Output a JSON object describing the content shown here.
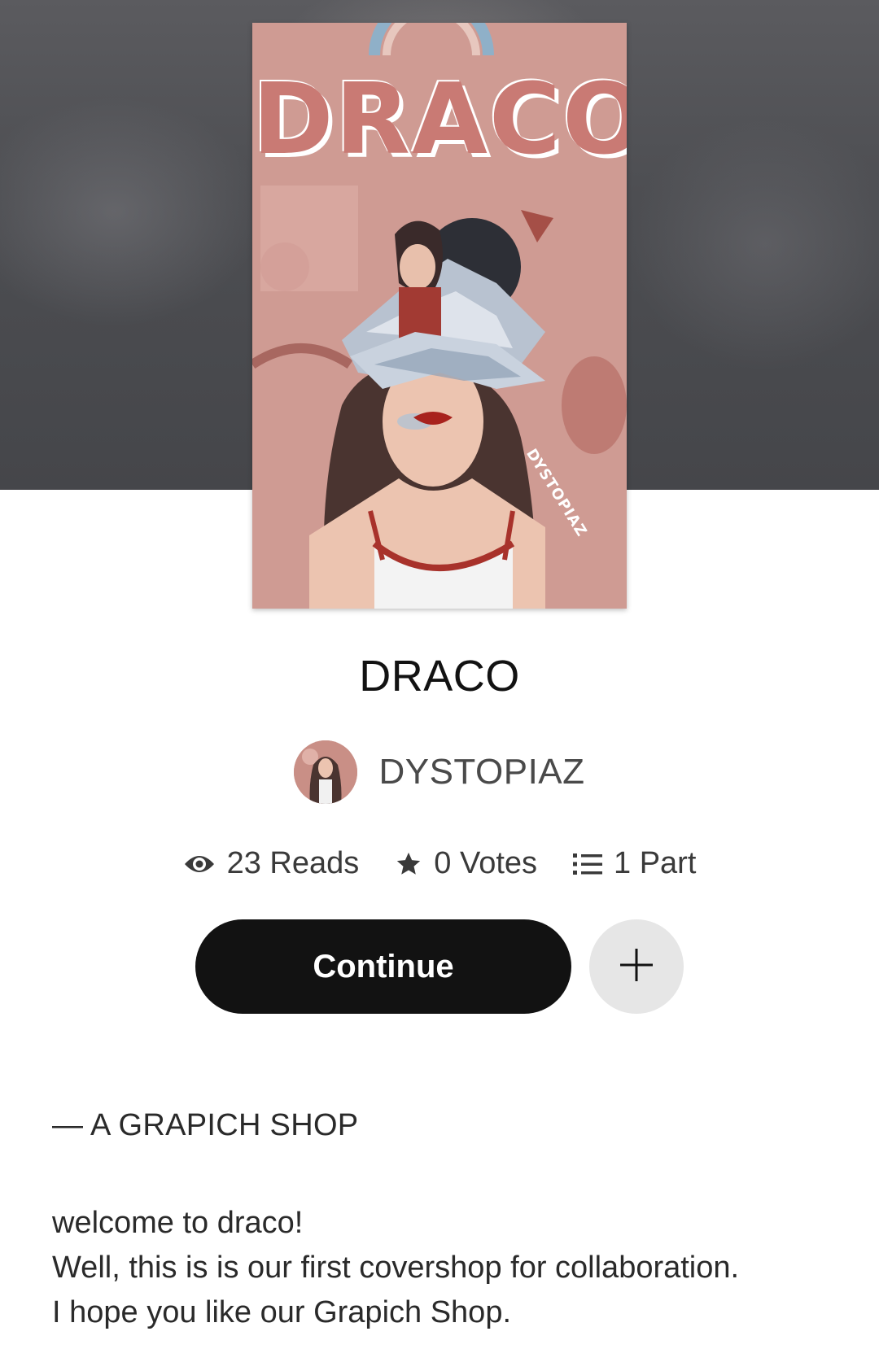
{
  "story": {
    "title": "DRACO",
    "cover": {
      "title_text": "DRACO",
      "watermark": "DYSTOPIAZ"
    }
  },
  "author": {
    "name": "DYSTOPIAZ"
  },
  "stats": {
    "reads": "23 Reads",
    "votes": "0 Votes",
    "parts": "1 Part"
  },
  "actions": {
    "continue_label": "Continue",
    "add_icon": "plus-icon"
  },
  "description": {
    "heading": "— A GRAPICH SHOP",
    "lines": [
      "welcome to draco!",
      "Well, this is is our first covershop for collaboration.",
      "I hope you like our Grapich Shop."
    ]
  },
  "colors": {
    "button_dark": "#121212",
    "button_light": "#e6e6e6",
    "cover_pink": "#c98f86",
    "text_secondary": "#4a4a4a"
  }
}
